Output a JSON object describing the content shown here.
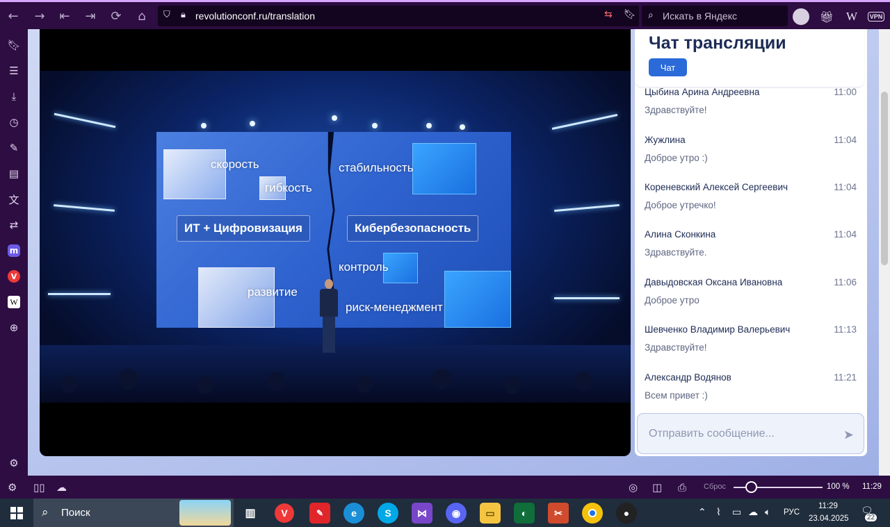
{
  "browser": {
    "url": "revolutionconf.ru/translation",
    "search_placeholder": "Искать в Яндекс",
    "vpn_label": "VPN",
    "zoom_reset_label": "Сброс",
    "zoom_value": "100 %",
    "time": "11:29"
  },
  "stage": {
    "words": {
      "speed": "скорость",
      "flex": "гибкость",
      "stability": "стабильность",
      "control": "контроль",
      "development": "развитие",
      "risk": "риск-менеджмент"
    },
    "boxes": {
      "it": "ИТ + Цифровизация",
      "security": "Кибербезопасность"
    }
  },
  "chat": {
    "title": "Чат трансляции",
    "tab": "Чат",
    "messages": [
      {
        "name": "Цыбина Арина Андреевна",
        "time": "11:00",
        "text": "Здравствуйте!"
      },
      {
        "name": "Жужлина",
        "time": "11:04",
        "text": "Доброе утро :)"
      },
      {
        "name": "Кореневский Алексей Сергеевич",
        "time": "11:04",
        "text": "Доброе утречко!"
      },
      {
        "name": "Алина Сконкина",
        "time": "11:04",
        "text": "Здравствуйте."
      },
      {
        "name": "Давыдовская Оксана Ивановна",
        "time": "11:06",
        "text": "Доброе утро"
      },
      {
        "name": "Шевченко Владимир Валерьевич",
        "time": "11:13",
        "text": "Здравствуйте!"
      },
      {
        "name": "Александр Водянов",
        "time": "11:21",
        "text": "Всем привет :)"
      }
    ],
    "input_placeholder": "Отправить сообщение..."
  },
  "taskbar": {
    "search_label": "Поиск",
    "language": "РУС",
    "time": "11:29",
    "date": "23.04.2025",
    "notifications": "22"
  },
  "zoom_level": 0.2
}
